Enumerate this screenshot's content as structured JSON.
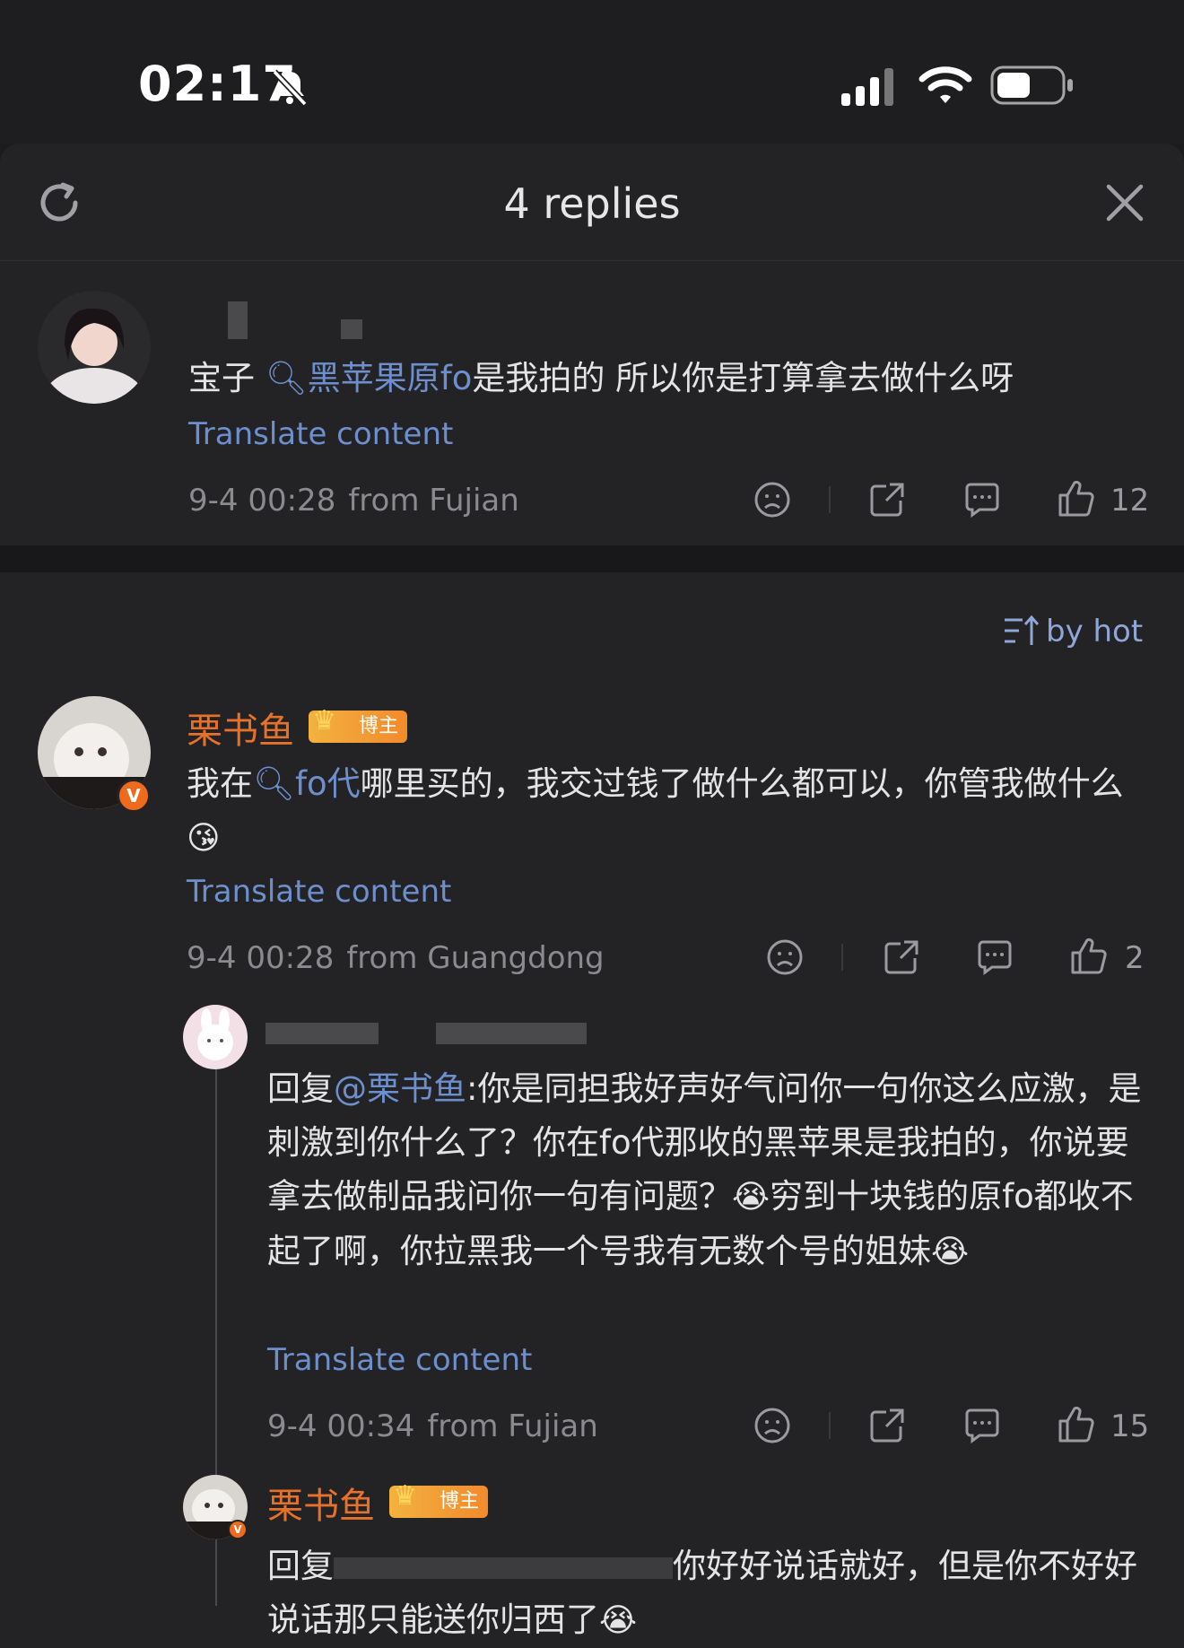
{
  "status_bar": {
    "time": "02:17"
  },
  "header": {
    "title": "4 replies"
  },
  "root_comment": {
    "text_before": "宝子 ",
    "link_text": "黑苹果原fo",
    "text_after": "是我拍的 所以你是打算拿去做什么呀",
    "translate": "Translate content",
    "date": "9-4 00:28",
    "location": "from Fujian",
    "likes": "12"
  },
  "sort_label": "by hot",
  "reply1": {
    "username": "栗书鱼",
    "badge": "博主",
    "text_before": "我在",
    "link_text": "fo代",
    "text_after": "哪里买的，我交过钱了做什么都可以，你管我做什么",
    "translate": "Translate content",
    "date": "9-4 00:28",
    "location": "from Guangdong",
    "likes": "2"
  },
  "reply2": {
    "reply_prefix": "回复",
    "mention": "@栗书鱼",
    "text": ":你是同担我好声好气问你一句你这么应激，是刺激到你什么了？你在fo代那收的黑苹果是我拍的，你说要拿去做制品我问你一句有问题？",
    "text_2": "穷到十块钱的原fo都收不起了啊，你拉黑我一个号我有无数个号的姐妹",
    "translate": "Translate content",
    "date": "9-4 00:34",
    "location": "from Fujian",
    "likes": "15"
  },
  "reply3": {
    "username": "栗书鱼",
    "badge": "博主",
    "reply_prefix": "回复",
    "text_tail": "你好好说话就好，但是你不好好说话那只能送你归西了"
  },
  "icons": [
    "refresh-icon",
    "close-icon",
    "dislike-icon",
    "share-icon",
    "comment-icon",
    "like-icon",
    "sort-icon",
    "bell-off-icon",
    "signal-icon",
    "wifi-icon",
    "battery-icon"
  ]
}
